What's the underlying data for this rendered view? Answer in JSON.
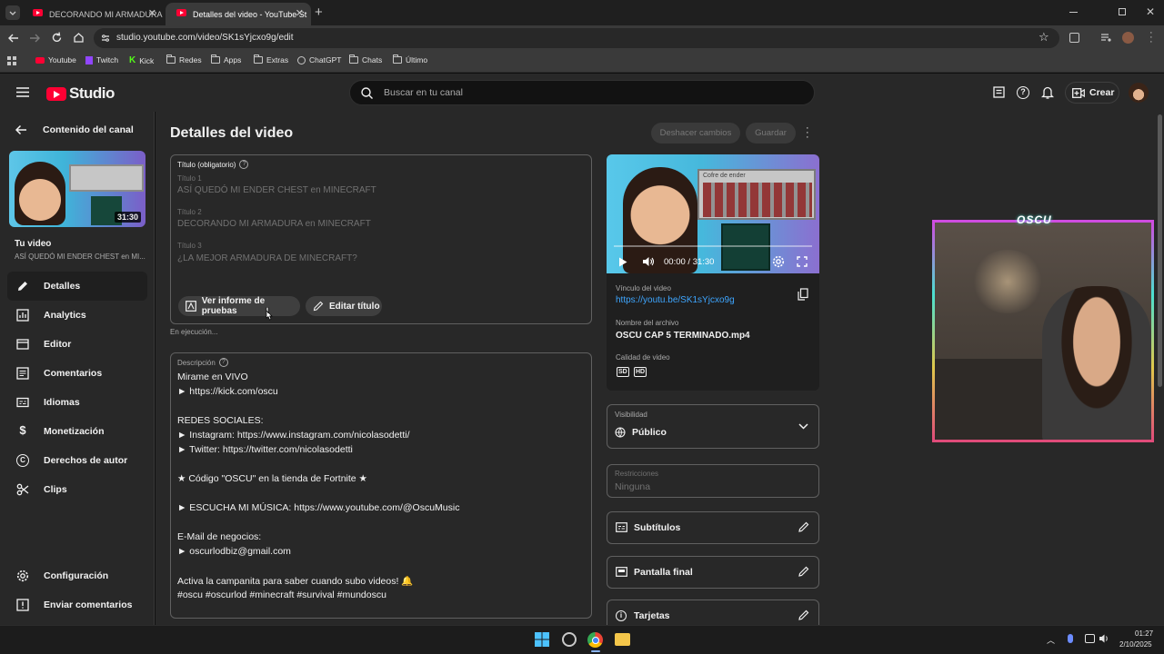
{
  "browser": {
    "tabs": [
      {
        "title": "DECORANDO MI ARMADURA e",
        "active": false
      },
      {
        "title": "Detalles del video - YouTube St",
        "active": true
      }
    ],
    "url": "studio.youtube.com/video/SK1sYjcxo9g/edit",
    "bookmarks": [
      "Youtube",
      "Twitch",
      "Kick",
      "Redes",
      "Apps",
      "Extras",
      "ChatGPT",
      "Chats",
      "Último"
    ]
  },
  "header": {
    "logo_text": "Studio",
    "search_placeholder": "Buscar en tu canal",
    "create_label": "Crear"
  },
  "sidebar": {
    "back_label": "Contenido del canal",
    "thumb_duration": "31:30",
    "your_video_label": "Tu video",
    "video_title_short": "ASÍ QUEDÓ MI ENDER CHEST en MI...",
    "items": [
      {
        "label": "Detalles",
        "icon": "pencil-icon",
        "selected": true
      },
      {
        "label": "Analytics",
        "icon": "analytics-icon",
        "selected": false
      },
      {
        "label": "Editor",
        "icon": "editor-icon",
        "selected": false
      },
      {
        "label": "Comentarios",
        "icon": "comments-icon",
        "selected": false
      },
      {
        "label": "Idiomas",
        "icon": "subtitles-icon",
        "selected": false
      },
      {
        "label": "Monetización",
        "icon": "dollar-icon",
        "selected": false
      },
      {
        "label": "Derechos de autor",
        "icon": "copyright-icon",
        "selected": false
      },
      {
        "label": "Clips",
        "icon": "scissors-icon",
        "selected": false
      }
    ],
    "bottom_items": [
      {
        "label": "Configuración",
        "icon": "gear-icon"
      },
      {
        "label": "Enviar comentarios",
        "icon": "feedback-icon"
      }
    ]
  },
  "main": {
    "page_title": "Detalles del video",
    "undo_label": "Deshacer cambios",
    "save_label": "Guardar",
    "title_section": {
      "label": "Título (obligatorio)",
      "titles": [
        {
          "label": "Título 1",
          "value": "ASÍ QUEDÓ MI ENDER CHEST en MINECRAFT"
        },
        {
          "label": "Título 2",
          "value": "DECORANDO MI ARMADURA en MINECRAFT"
        },
        {
          "label": "Título 3",
          "value": "¿LA MEJOR ARMADURA DE MINECRAFT?"
        }
      ],
      "report_button": "Ver informe de pruebas",
      "edit_button": "Editar título",
      "status": "En ejecución..."
    },
    "description": {
      "label": "Descripción",
      "lines": [
        "Mirame en VIVO",
        "► https://kick.com/oscu",
        "",
        "REDES SOCIALES:",
        "► Instagram: https://www.instagram.com/nicolasodetti/",
        "► Twitter: https://twitter.com/nicolasodetti",
        "",
        "★ Código \"OSCU\" en la tienda de Fortnite ★",
        "",
        "► ESCUCHA MI MÚSICA: https://www.youtube.com/@OscuMusic",
        "",
        "E-Mail de negocios:",
        "► oscurlodbiz@gmail.com",
        "",
        "Activa la campanita para saber cuando subo videos! 🔔",
        "#oscu #oscurlod #minecraft #survival #mundoscu"
      ]
    }
  },
  "video_panel": {
    "time": "00:00 / 31:30",
    "link_label": "Vínculo del video",
    "link": "https://youtu.be/SK1sYjcxo9g",
    "filename_label": "Nombre del archivo",
    "filename": "OSCU CAP 5 TERMINADO.mp4",
    "quality_label": "Calidad de video",
    "quality_badges": [
      "SD",
      "HD"
    ],
    "chest_title": "Cofre de ender",
    "visibility_label": "Visibilidad",
    "visibility_value": "Público",
    "restrictions_label": "Restricciones",
    "restrictions_value": "Ninguna",
    "cards": [
      {
        "label": "Subtítulos",
        "icon": "subtitles-icon"
      },
      {
        "label": "Pantalla final",
        "icon": "end-screen-icon"
      },
      {
        "label": "Tarjetas",
        "icon": "info-icon"
      }
    ]
  },
  "webcam": {
    "overlay_text": "OSCU"
  },
  "taskbar": {
    "time": "01:27",
    "date": "2/10/2025"
  }
}
